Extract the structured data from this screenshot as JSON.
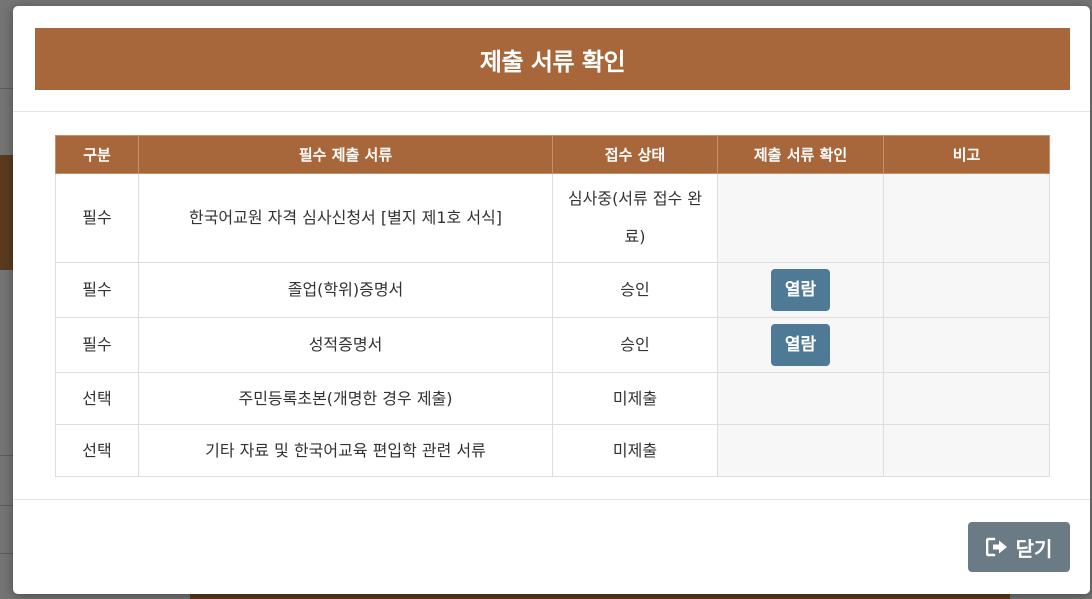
{
  "modal": {
    "title": "제출 서류 확인",
    "close_label": "닫기",
    "accent_color": "#a8673b",
    "button_color": "#4f7a96"
  },
  "table": {
    "headers": [
      "구분",
      "필수 제출 서류",
      "접수 상태",
      "제출 서류 확인",
      "비고"
    ],
    "rows": [
      {
        "category": "필수",
        "document": "한국어교원 자격 심사신청서 [별지 제1호 서식]",
        "status": "심사중(서류 접수 완료)",
        "action": "",
        "note": ""
      },
      {
        "category": "필수",
        "document": "졸업(학위)증명서",
        "status": "승인",
        "action": "열람",
        "note": ""
      },
      {
        "category": "필수",
        "document": "성적증명서",
        "status": "승인",
        "action": "열람",
        "note": ""
      },
      {
        "category": "선택",
        "document": "주민등록초본(개명한 경우 제출)",
        "status": "미제출",
        "action": "",
        "note": ""
      },
      {
        "category": "선택",
        "document": "기타 자료 및 한국어교육 편입학 관련 서류",
        "status": "미제출",
        "action": "",
        "note": ""
      }
    ]
  }
}
